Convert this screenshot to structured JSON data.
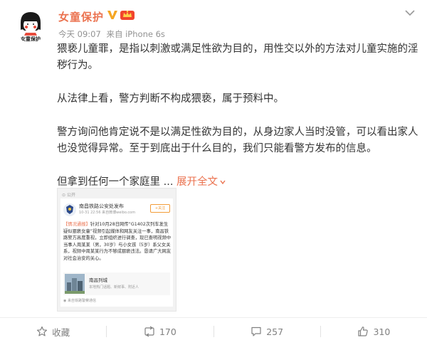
{
  "header": {
    "username": "女童保护",
    "verified_icon": "verified-v-icon",
    "vip_icon": "vip-crown-icon",
    "time": "今天 09:07",
    "source": "来自 iPhone 6s",
    "avatar_caption": "女童保护",
    "accent": "#eb7350"
  },
  "content": {
    "paragraphs": [
      "猥亵儿童罪，是指以刺激或满足性欲为目的，用性交以外的方法对儿童实施的淫秽行为。",
      "从法律上看，警方判断不构成猥亵，属于预料中。",
      "警方询问他肯定说不是以满足性欲为目的，从身边家人当时没管，可以看出家人也没觉得异常。至于到底出于什么目的，我们只能看警方发布的信息。"
    ],
    "last_line": "但拿到任何一个家庭里 ...",
    "expand_label": "展开全文"
  },
  "embed": {
    "visibility": "公开",
    "name": "南昌铁路公安处发布",
    "time": "10-31 22:56  来自微博weibo.com",
    "follow": "+关注",
    "tag": "【情况通报】",
    "text": "针对10月28日网传“G1402次列车发生疑似猥亵女童”视频引起媒体和网友关注一事，南昌铁路警方高度重视，立即组织进行调查，现已查明视频中当事人周某某（男，30岁）与小女孩（5岁）系父女关系，视频中周某某行为不够成猥亵违法。恳请广大网友对社会治安的关心。",
    "link_title": "南昌列城",
    "link_sub": "本地热门话题、新鲜事、附近人",
    "footer": "来自铁路警察通信"
  },
  "actions": {
    "favorite_label": "收藏",
    "repost_count": "170",
    "comment_count": "257",
    "like_count": "310"
  }
}
